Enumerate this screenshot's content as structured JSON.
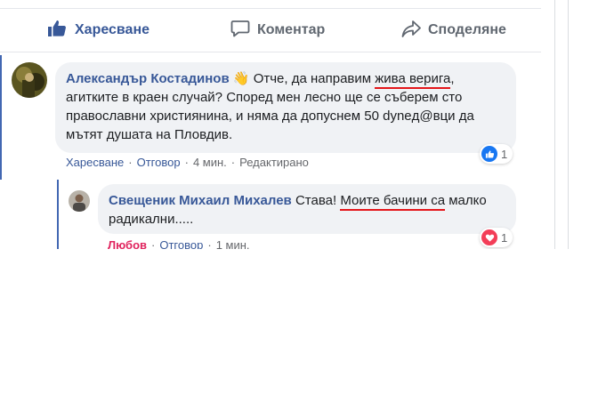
{
  "actions": {
    "like_label": "Харесване",
    "comment_label": "Коментар",
    "share_label": "Споделяне"
  },
  "comments": [
    {
      "author": "Александър Костадинов",
      "emoji": "👋",
      "text_before": "Отче, да направим ",
      "text_underlined": "жива верига",
      "text_after": ", агитките в краен случай? Според мен лесно ще се съберем сто православни християнина, и няма да допуснем 50 dyneд@вци да мътят душата на Пловдив.",
      "reaction_count": "1",
      "reaction_type": "like",
      "meta": {
        "like": "Харесване",
        "reply": "Отговор",
        "time": "4 мин.",
        "edited": "Редактирано"
      }
    }
  ],
  "reply": {
    "author": "Свещеник Михаил Михалев",
    "text_before": "Става! ",
    "text_underlined": "Моите бачини са",
    "text_after": " малко радикални.....",
    "reaction_count": "1",
    "reaction_type": "love",
    "meta": {
      "love": "Любов",
      "reply": "Отговор",
      "time": "1 мин."
    }
  },
  "colors": {
    "brand": "#385898",
    "underline": "#e4161b",
    "love": "#e0245e",
    "bubble": "#f0f2f5"
  }
}
